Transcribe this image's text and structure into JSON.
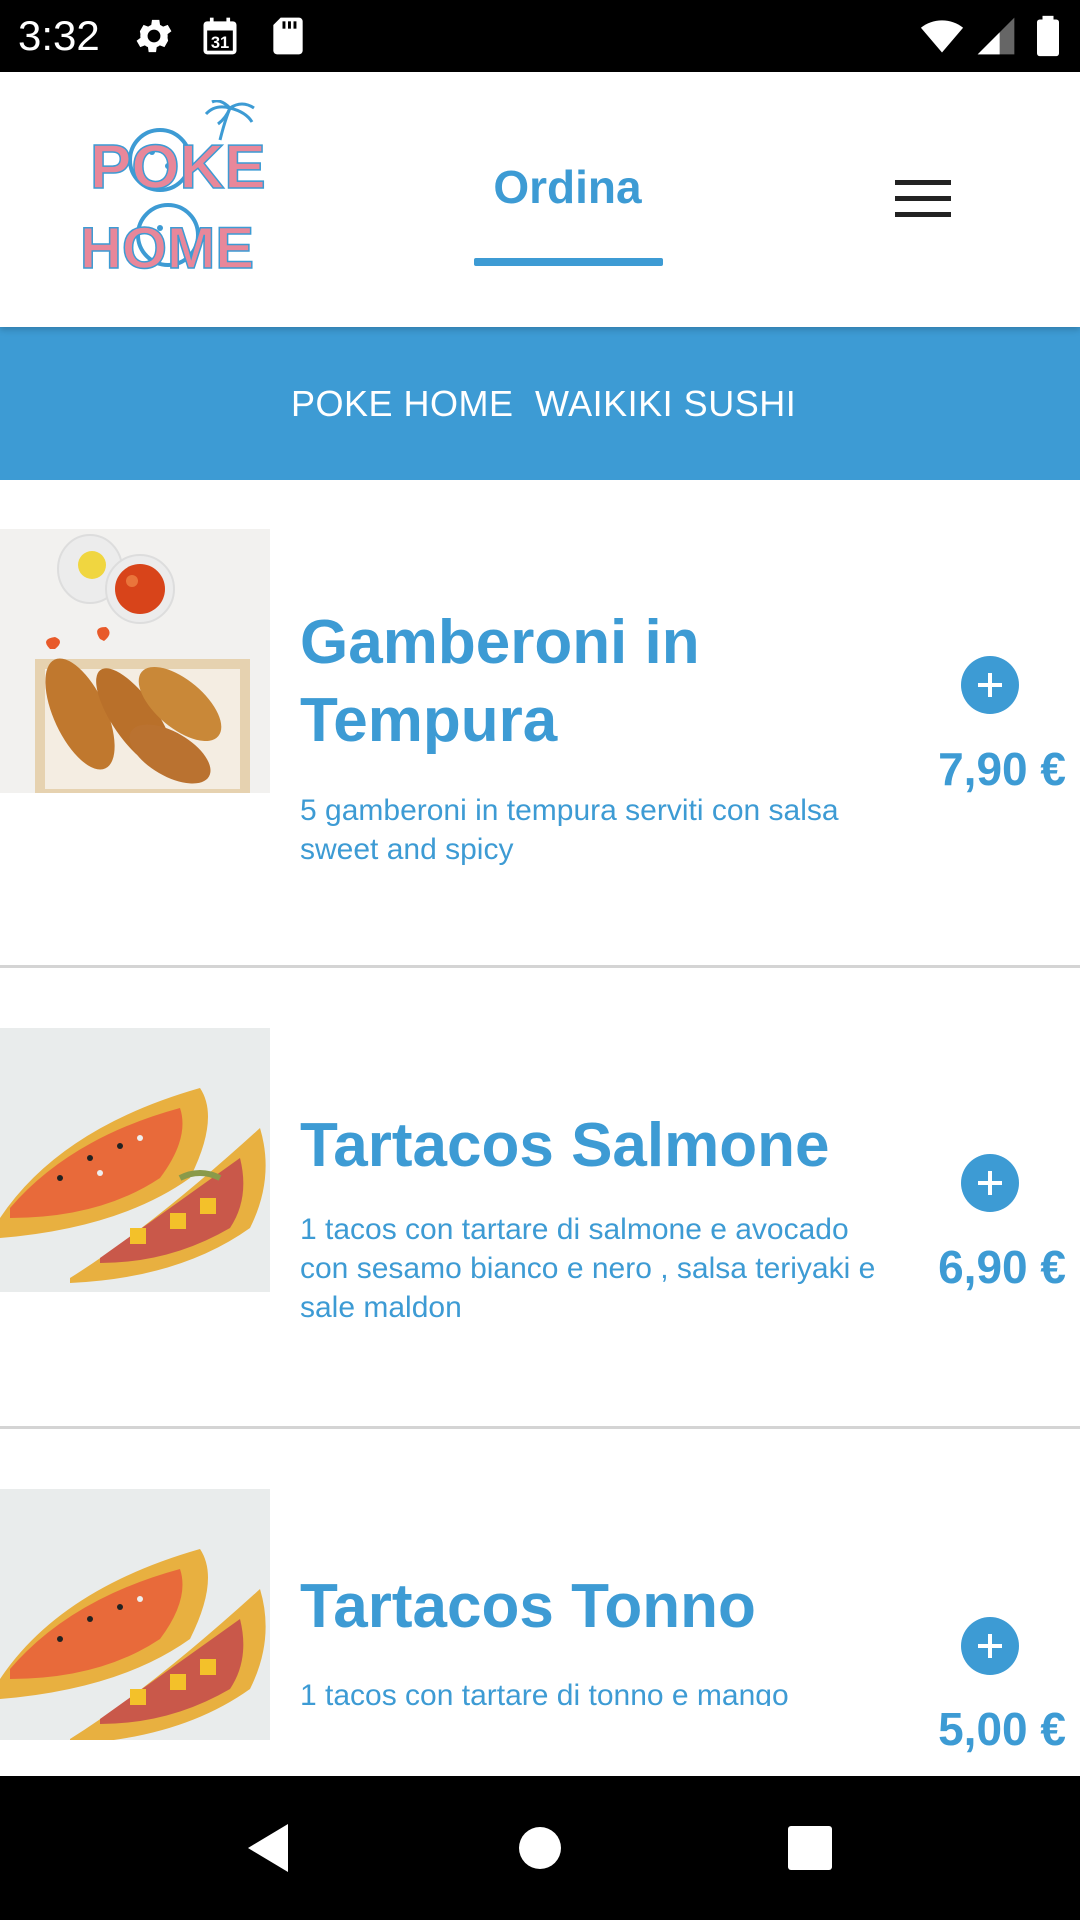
{
  "status_bar": {
    "time": "3:32",
    "calendar_day": "31",
    "icons": [
      "settings-icon",
      "calendar-icon",
      "sd-card-icon",
      "wifi-icon",
      "signal-icon",
      "battery-icon"
    ]
  },
  "header": {
    "logo_text": [
      "POKE",
      "HOME"
    ],
    "tab_label": "Ordina",
    "menu_icon": "hamburger-menu-icon"
  },
  "categories": [
    "POKE HOME",
    "WAIKIKI SUSHI"
  ],
  "products": [
    {
      "title": "Gamberoni in Tempura",
      "description": "5 gamberoni in tempura serviti con salsa sweet and spicy",
      "price": "7,90 €"
    },
    {
      "title": "Tartacos Salmone",
      "description": "1 tacos con tartare di salmone e avocado con sesamo bianco e nero , salsa teriyaki e sale maldon",
      "price": "6,90 €"
    },
    {
      "title": "Tartacos Tonno",
      "description": "1 tacos con tartare di tonno e mango",
      "price": "5,00 €"
    }
  ],
  "colors": {
    "accent": "#3d9bd4",
    "logo_pink": "#e8879a",
    "status_bar": "#000000",
    "divider": "#d4d4d4"
  },
  "nav_bar": [
    "back-icon",
    "home-icon",
    "recents-icon"
  ]
}
